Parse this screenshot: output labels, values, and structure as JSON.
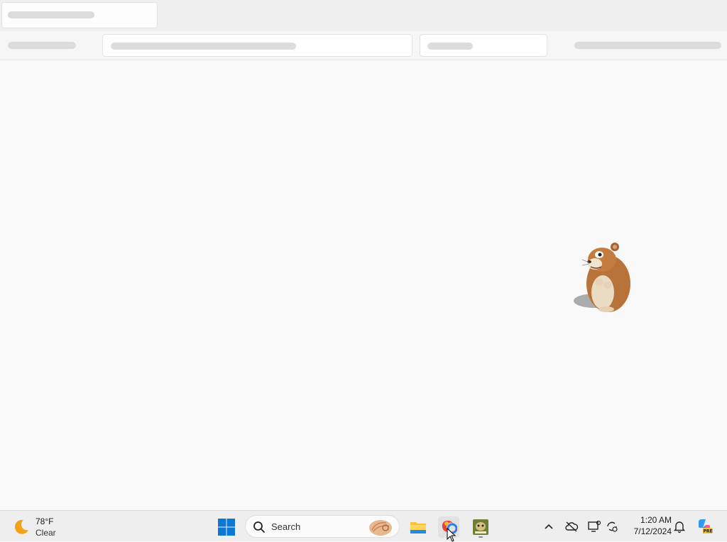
{
  "taskbar": {
    "weather": {
      "temperature": "78°F",
      "condition": "Clear",
      "icon": "moon-icon"
    },
    "search": {
      "label": "Search"
    },
    "apps": [
      {
        "name": "file-explorer",
        "icon": "folder-icon"
      },
      {
        "name": "browser",
        "icon": "browser-icon",
        "active": true
      },
      {
        "name": "game",
        "icon": "game-icon",
        "running": true
      }
    ],
    "tray": {
      "icons": [
        "chevron-up-icon",
        "cloud-off-icon",
        "device-settings-icon",
        "sync-icon"
      ],
      "time": "1:20 AM",
      "date": "7/12/2024",
      "notification_icon": "bell-icon",
      "copilot_icon": "copilot-pre-icon"
    }
  },
  "content": {
    "mascot": "hamster-image"
  },
  "colors": {
    "page_bg": "#f9f9f9",
    "taskbar_bg": "#eeeeee",
    "skeleton": "#dcdcdc",
    "win_blue": "#0a78d4"
  }
}
